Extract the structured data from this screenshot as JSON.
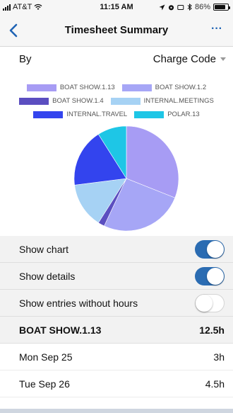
{
  "status_bar": {
    "carrier": "AT&T",
    "time": "11:15 AM",
    "battery": "86%",
    "battery_level": 0.86
  },
  "nav": {
    "title": "Timesheet Summary",
    "more": "···"
  },
  "by": {
    "label": "By",
    "value": "Charge Code"
  },
  "chart_data": {
    "type": "pie",
    "legend_position": "top",
    "series": [
      {
        "name": "BOAT SHOW.1.13",
        "value": 31,
        "color": "#a79cf4"
      },
      {
        "name": "BOAT SHOW.1.2",
        "value": 26,
        "color": "#a6a6f6"
      },
      {
        "name": "BOAT SHOW.1.4",
        "value": 2,
        "color": "#5b4ec0"
      },
      {
        "name": "INTERNAL.MEETINGS",
        "value": 14,
        "color": "#a6d2f4"
      },
      {
        "name": "INTERNAL.TRAVEL",
        "value": 18,
        "color": "#3344ee"
      },
      {
        "name": "POLAR.13",
        "value": 9,
        "color": "#1ec6e6"
      }
    ]
  },
  "toggles": [
    {
      "label": "Show chart",
      "on": true
    },
    {
      "label": "Show details",
      "on": true
    },
    {
      "label": "Show entries without hours",
      "on": false
    }
  ],
  "group": {
    "name": "BOAT SHOW.1.13",
    "total": "12.5h"
  },
  "entries": [
    {
      "date": "Mon Sep 25",
      "hours": "3h"
    },
    {
      "date": "Tue Sep 26",
      "hours": "4.5h"
    }
  ],
  "colors": {
    "accent": "#2b6cb2",
    "nav_accent": "#2064b4"
  }
}
